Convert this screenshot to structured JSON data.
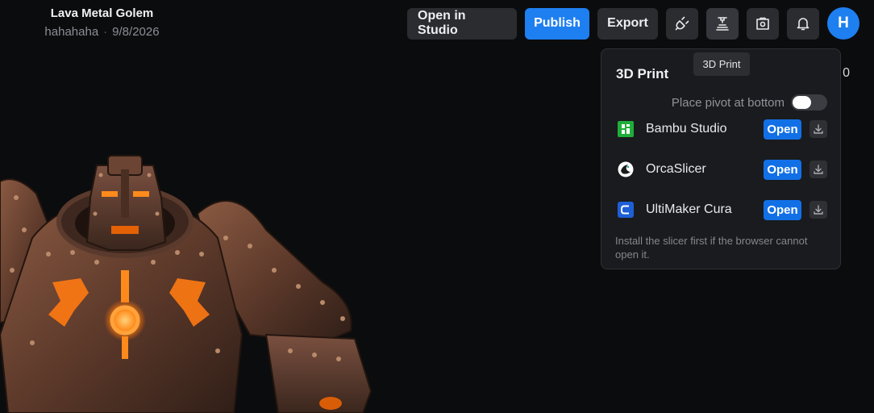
{
  "asset": {
    "title": "Lava Metal Golem",
    "author": "hahahaha",
    "date": "9/8/2026"
  },
  "toolbar": {
    "open_in_studio": "Open in Studio",
    "publish": "Publish",
    "export": "Export",
    "icons": [
      "api-plug-icon",
      "3d-print-icon",
      "store-icon",
      "bell-icon"
    ],
    "avatar_initial": "H"
  },
  "tooltip": "3D Print",
  "peek_text": "0",
  "print_panel": {
    "title": "3D Print",
    "pivot_label": "Place pivot at bottom",
    "pivot_enabled": false,
    "slicers": [
      {
        "name": "Bambu Studio",
        "open_label": "Open",
        "icon": "bambu-studio-icon"
      },
      {
        "name": "OrcaSlicer",
        "open_label": "Open",
        "icon": "orcaslicer-icon"
      },
      {
        "name": "UltiMaker Cura",
        "open_label": "Open",
        "icon": "ultimaker-cura-icon"
      }
    ],
    "hint": "Install the slicer first if the browser cannot open it."
  },
  "colors": {
    "accent": "#1e7ff0",
    "background": "#0b0c0e",
    "panel": "#1a1b1e",
    "lava_glow": "#ff8a1c"
  }
}
